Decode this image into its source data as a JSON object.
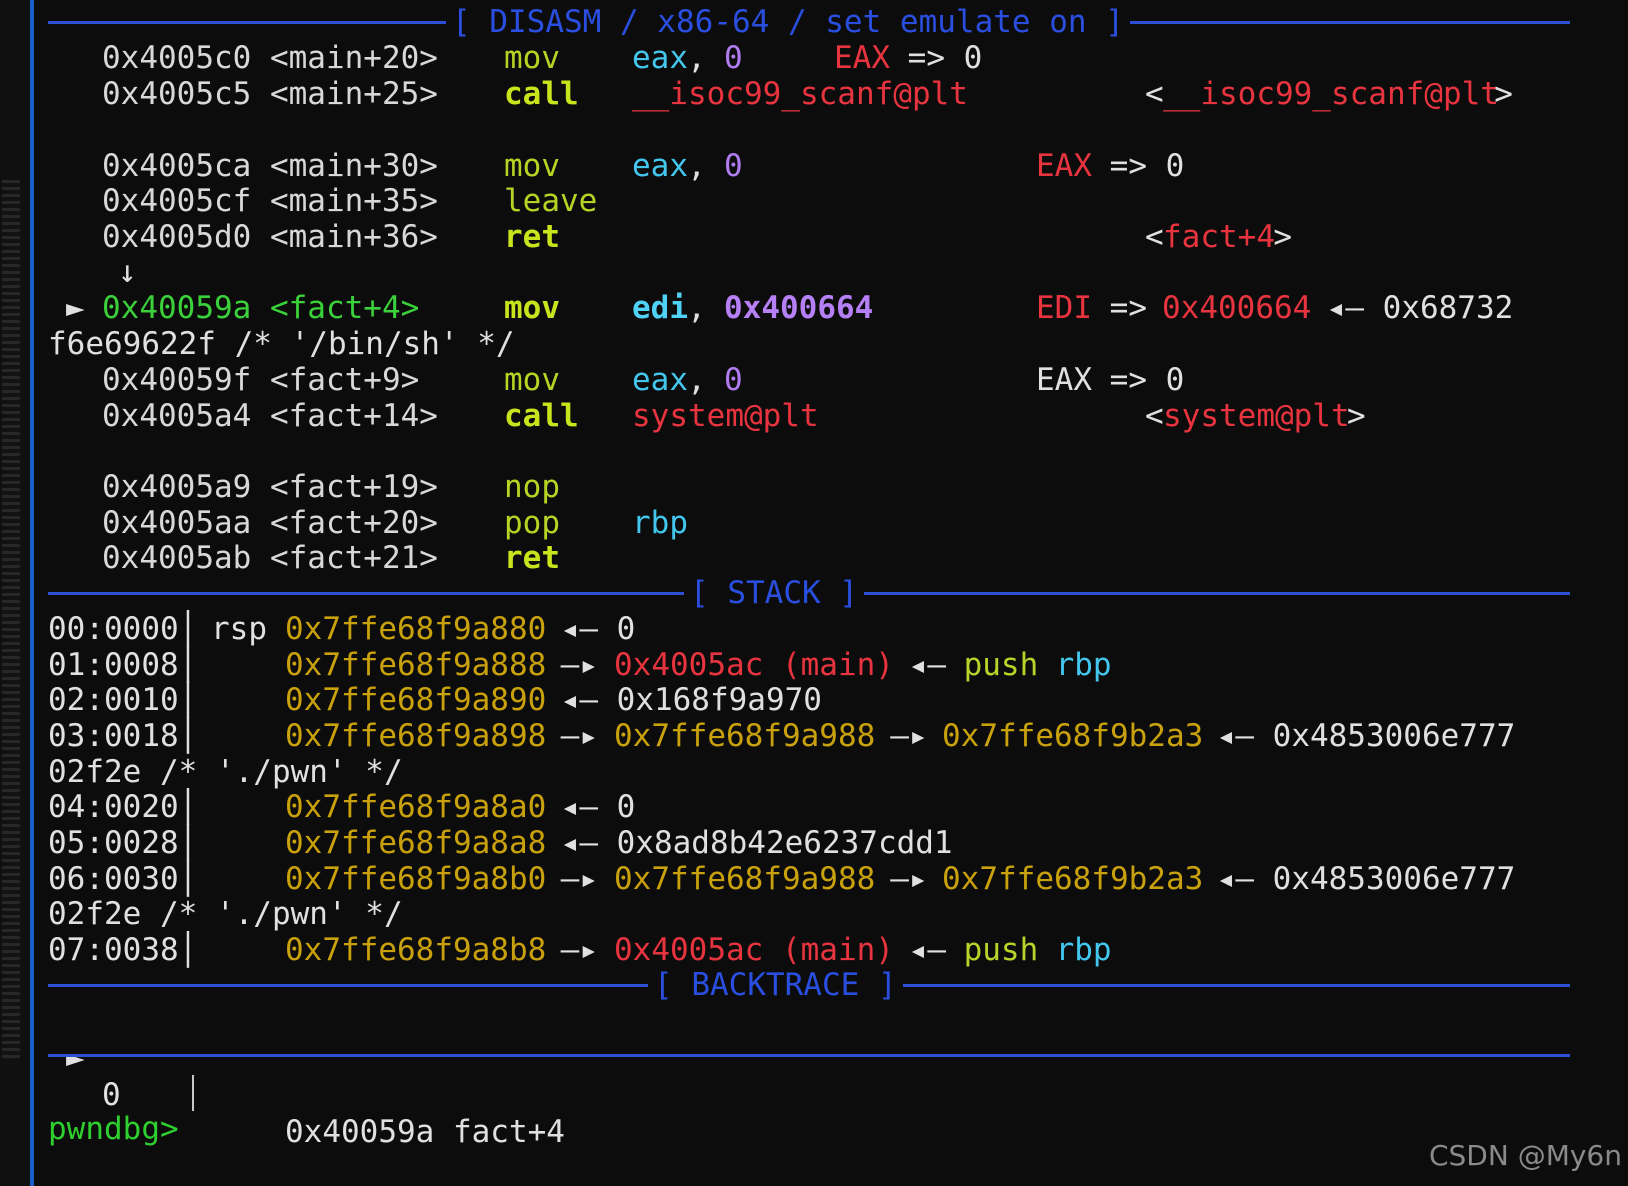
{
  "headers": {
    "disasm": "[ DISASM / x86-64 / set emulate on ]",
    "stack": "[ STACK ]",
    "backtrace": "[ BACKTRACE ]"
  },
  "disasm": [
    {
      "addr": "0x4005c0 <main+20>",
      "mnem": "mov",
      "op1": "eax",
      "comma": ",",
      "op2": "0",
      "comment_reg": "EAX",
      "comment_rest": " => 0"
    },
    {
      "addr": "0x4005c5 <main+25>",
      "mnem": "call",
      "target": "__isoc99_scanf@plt",
      "sym_open": "<",
      "sym": "__isoc99_scanf@plt",
      "sym_close": ">"
    },
    {
      "addr": "0x4005ca <main+30>",
      "mnem": "mov",
      "op1": "eax",
      "comma": ",",
      "op2": "0",
      "comment_reg": "EAX",
      "comment_rest": " => 0"
    },
    {
      "addr": "0x4005cf <main+35>",
      "mnem": "leave"
    },
    {
      "addr": "0x4005d0 <main+36>",
      "mnem": "ret",
      "sym_open": "<",
      "sym": "fact+4",
      "sym_close": ">"
    },
    {
      "arrow": "↓"
    },
    {
      "marker": "►",
      "addr": "0x40059a <fact+4>",
      "mnem": "mov",
      "op1": "edi",
      "comma": ",",
      "op2": "0x400664",
      "comment_reg": "EDI",
      "comment_arrow": " => ",
      "comment_val": "0x400664",
      "comment_tail": " ◂— 0x68732"
    },
    {
      "wrap": "f6e69622f /* '/bin/sh' */"
    },
    {
      "addr": "0x40059f <fact+9>",
      "mnem": "mov",
      "op1": "eax",
      "comma": ",",
      "op2": "0",
      "comment_reg": "EAX",
      "comment_rest": " => 0"
    },
    {
      "addr": "0x4005a4 <fact+14>",
      "mnem": "call",
      "target": "system@plt",
      "sym_open": "<",
      "sym": "system@plt",
      "sym_close": ">"
    },
    {
      "addr": "0x4005a9 <fact+19>",
      "mnem": "nop"
    },
    {
      "addr": "0x4005aa <fact+20>",
      "mnem": "pop",
      "op1": "rbp"
    },
    {
      "addr": "0x4005ab <fact+21>",
      "mnem": "ret"
    }
  ],
  "stack": [
    {
      "idx": "00:0000│",
      "reg": "rsp",
      "addr": "0x7ffe68f9a880",
      "rest1": " ◂— 0"
    },
    {
      "idx": "01:0008│",
      "addr": "0x7ffe68f9a888",
      "arrow": " —▸ ",
      "p1": "0x4005ac (main)",
      "arrow2": " ◂— ",
      "ins": "push",
      "reg2": "rbp"
    },
    {
      "idx": "02:0010│",
      "addr": "0x7ffe68f9a890",
      "rest1": " ◂— 0x168f9a970"
    },
    {
      "idx": "03:0018│",
      "addr": "0x7ffe68f9a898",
      "arrow": " —▸ ",
      "p1": "0x7ffe68f9a988",
      "arrow2": " —▸ ",
      "p2": "0x7ffe68f9b2a3",
      "tail": " ◂— 0x4853006e777"
    },
    {
      "wrap": "02f2e /* './pwn' */"
    },
    {
      "idx": "04:0020│",
      "addr": "0x7ffe68f9a8a0",
      "rest1": " ◂— 0"
    },
    {
      "idx": "05:0028│",
      "addr": "0x7ffe68f9a8a8",
      "rest1": " ◂— 0x8ad8b42e6237cdd1"
    },
    {
      "idx": "06:0030│",
      "addr": "0x7ffe68f9a8b0",
      "arrow": " —▸ ",
      "p1": "0x7ffe68f9a988",
      "arrow2": " —▸ ",
      "p2": "0x7ffe68f9b2a3",
      "tail": " ◂— 0x4853006e777"
    },
    {
      "wrap": "02f2e /* './pwn' */"
    },
    {
      "idx": "07:0038│",
      "addr": "0x7ffe68f9a8b8",
      "arrow": " —▸ ",
      "p1": "0x4005ac (main)",
      "arrow2": " ◂— ",
      "ins": "push",
      "reg2": "rbp"
    }
  ],
  "backtrace": {
    "marker": "►",
    "frame": "0",
    "addr": "0x40059a fact+4"
  },
  "prompt": "pwndbg>",
  "watermark": "CSDN @My6n",
  "colors": {
    "separator": "#2d4fd6",
    "prompt": "#2fcf2f",
    "address_yellow": "#c9a10c",
    "red": "#e8343f"
  }
}
